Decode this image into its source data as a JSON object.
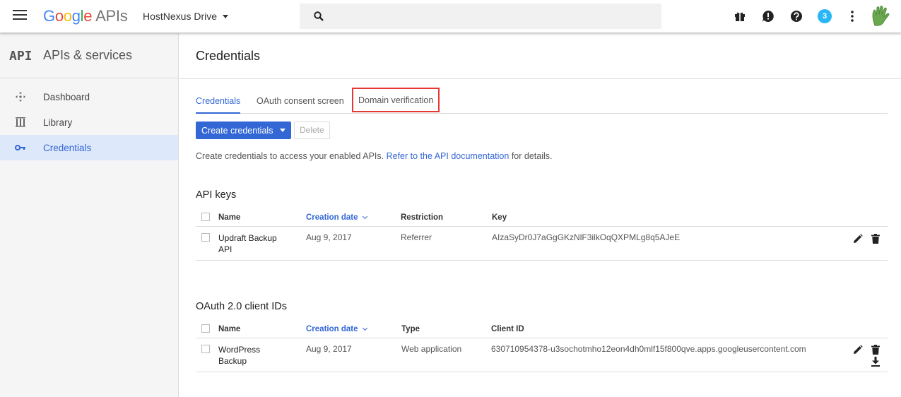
{
  "topbar": {
    "logo": {
      "g1": "G",
      "g2": "o",
      "g3": "o",
      "g4": "g",
      "g5": "l",
      "g6": "e",
      "suffix": "APIs"
    },
    "project": "HostNexus Drive",
    "search_placeholder": "",
    "notification_count": "3",
    "colors": {
      "badge": "#29b6f6"
    }
  },
  "sidebar": {
    "icon_text": "API",
    "title": "APIs & services",
    "items": [
      {
        "label": "Dashboard",
        "icon": "dashboard-icon"
      },
      {
        "label": "Library",
        "icon": "library-icon"
      },
      {
        "label": "Credentials",
        "icon": "key-icon",
        "active": true
      }
    ]
  },
  "main": {
    "title": "Credentials",
    "tabs": [
      {
        "label": "Credentials",
        "active": true
      },
      {
        "label": "OAuth consent screen"
      },
      {
        "label": "Domain verification",
        "highlighted": true
      }
    ],
    "create_button": "Create credentials",
    "delete_button": "Delete",
    "description": "Create credentials to access your enabled APIs.",
    "description_link": "Refer to the API documentation",
    "description_suffix": "for details.",
    "api_keys": {
      "title": "API keys",
      "columns": [
        "Name",
        "Creation date",
        "Restriction",
        "Key"
      ],
      "rows": [
        {
          "name_line1": "Updraft Backup",
          "name_line2": "API",
          "date": "Aug 9, 2017",
          "restriction": "Referrer",
          "key": "AIzaSyDr0J7aGgGKzNlF3ilkOqQXPMLg8q5AJeE"
        }
      ]
    },
    "oauth": {
      "title": "OAuth 2.0 client IDs",
      "columns": [
        "Name",
        "Creation date",
        "Type",
        "Client ID"
      ],
      "rows": [
        {
          "name_line1": "WordPress",
          "name_line2": "Backup",
          "date": "Aug 9, 2017",
          "type": "Web application",
          "client_id": "630710954378-u3sochotmho12eon4dh0mlf15f800qve.apps.googleusercontent.com"
        }
      ]
    },
    "colors": {
      "accent": "#3367d6",
      "highlight_box": "#e53935"
    }
  }
}
